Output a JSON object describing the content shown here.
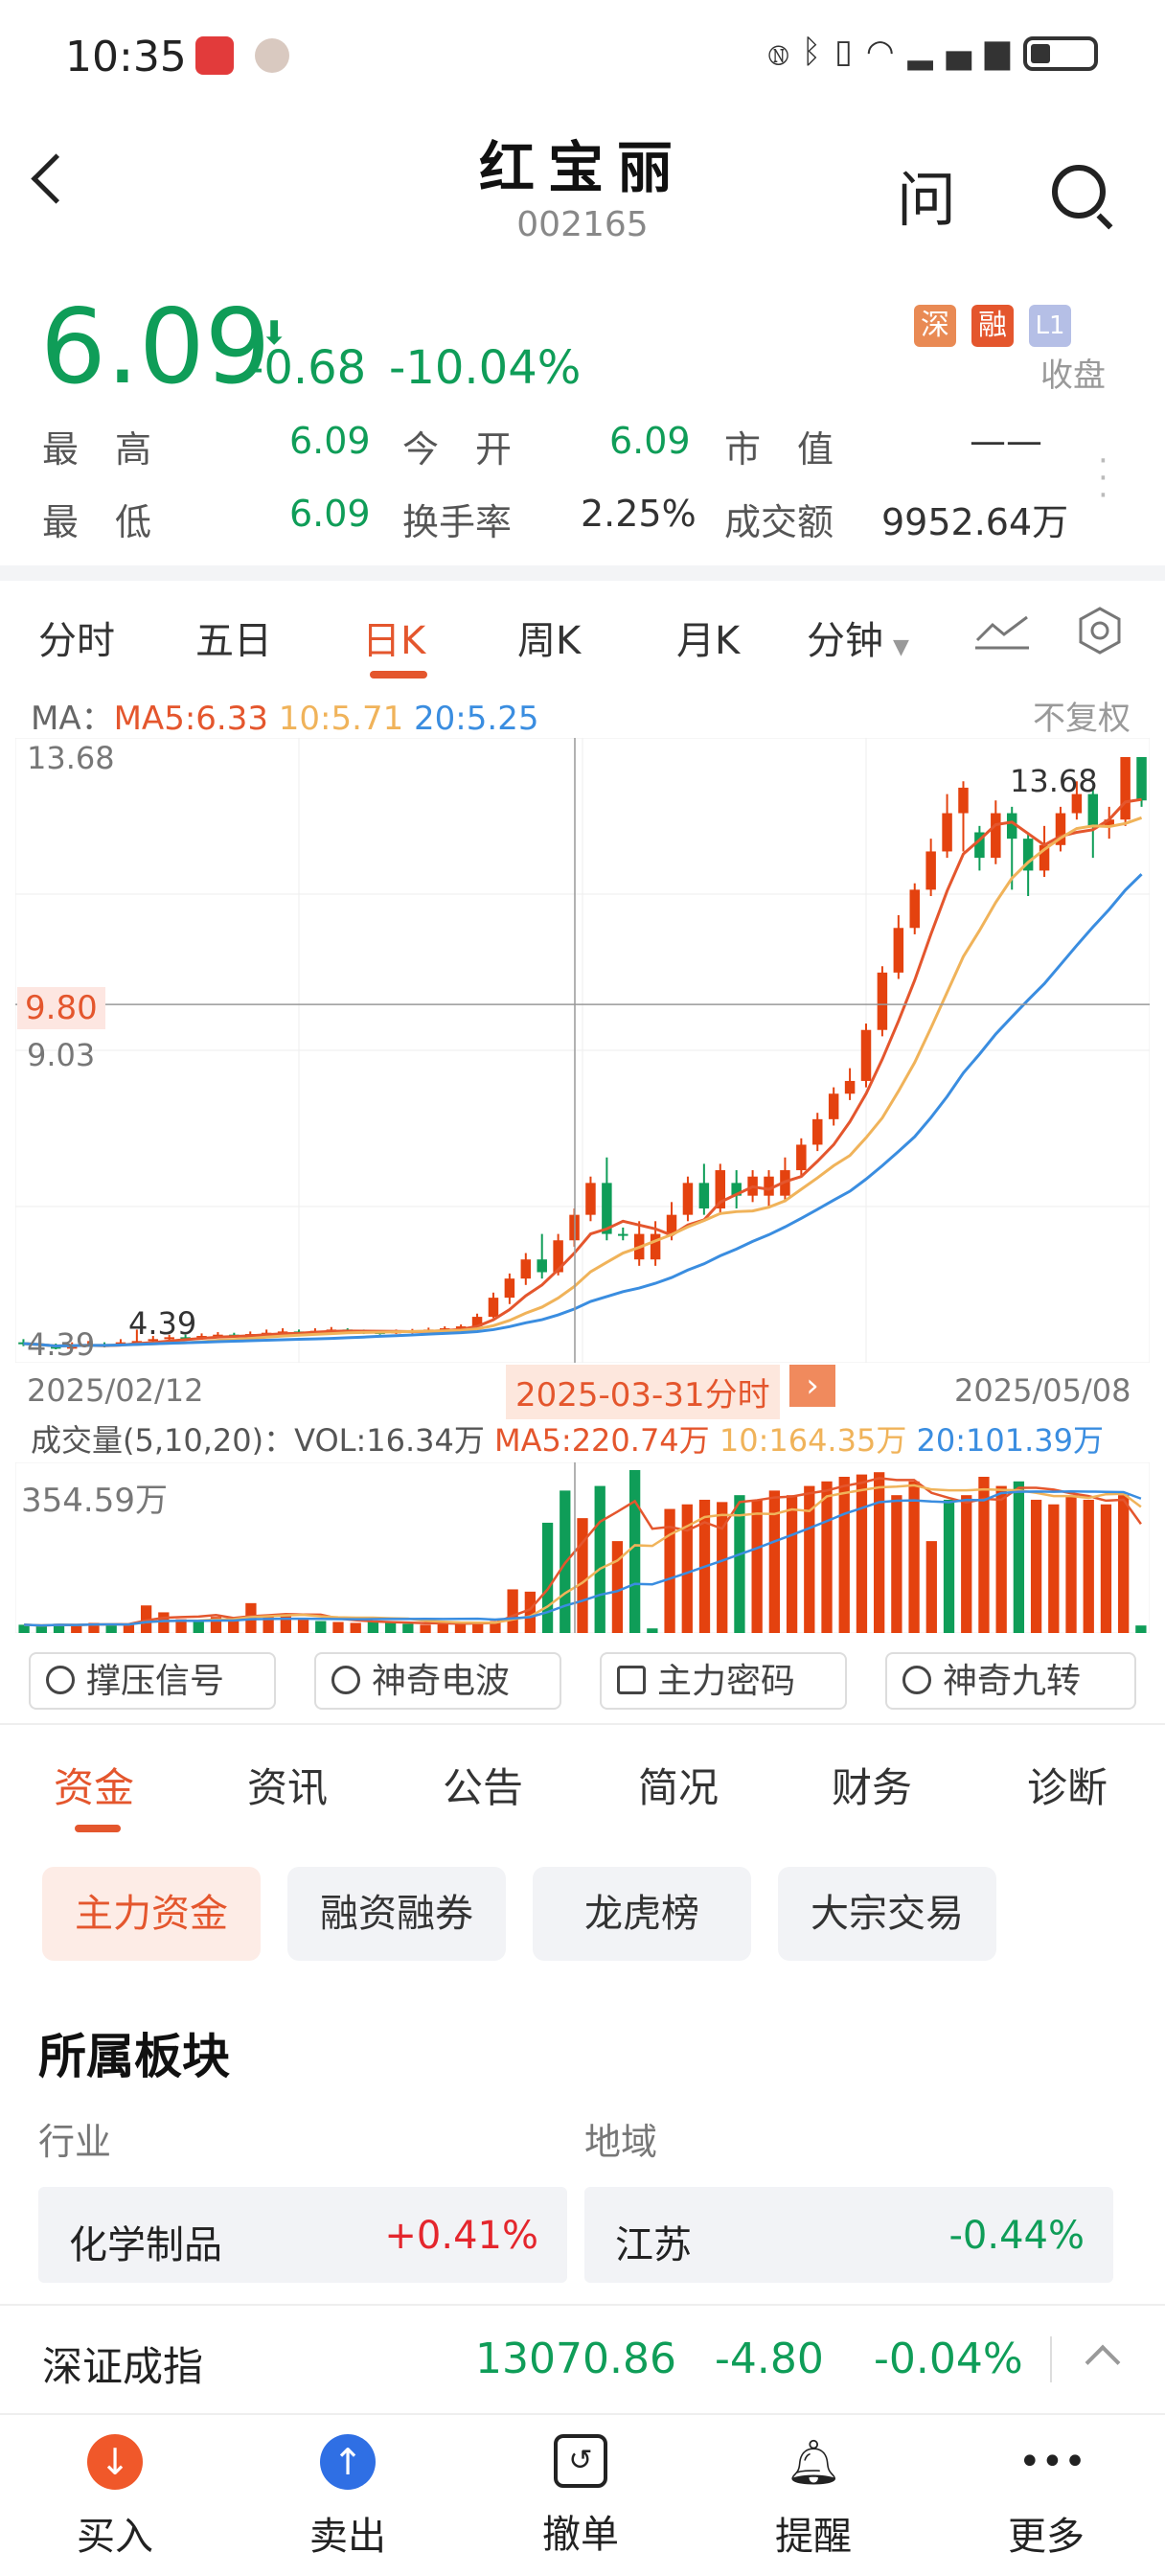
{
  "status_bar": {
    "time": "10:35"
  },
  "header": {
    "title": "红宝丽",
    "code": "002165"
  },
  "quote": {
    "price": "6.09",
    "change": "-0.68",
    "change_pct": "-10.04%",
    "badges": [
      "深",
      "融",
      "L1"
    ],
    "state": "收盘",
    "high_label": "最　高",
    "high": "6.09",
    "open_label": "今　开",
    "open": "6.09",
    "mcap_label": "市　值",
    "mcap": "——",
    "low_label": "最　低",
    "low": "6.09",
    "turnover_label": "换手率",
    "turnover": "2.25%",
    "amount_label": "成交额",
    "amount": "9952.64万"
  },
  "chart_tabs": [
    "分时",
    "五日",
    "日K",
    "周K",
    "月K",
    "分钟"
  ],
  "active_chart_tab": "日K",
  "ma_legend": {
    "prefix": "MA：",
    "ma5": "MA5:6.33",
    "ma10": "10:5.71",
    "ma20": "20:5.25",
    "adjust": "不复权"
  },
  "price_axis": {
    "top": "13.68",
    "cross": "9.80",
    "mid": "9.03",
    "bottom": "4.39",
    "high_mark": "13.68",
    "low_mark": "4.39"
  },
  "date_axis": {
    "start": "2025/02/12",
    "end": "2025/05/08",
    "cursor": "2025-03-31分时"
  },
  "vol_legend": {
    "prefix": "成交量(5,10,20)：",
    "vol": "VOL:16.34万",
    "ma5": "MA5:220.74万",
    "ma10": "10:164.35万",
    "ma20": "20:101.39万",
    "max": "354.59万"
  },
  "colors": {
    "up": "#e4420f",
    "down": "#0f9d58",
    "ma5": "#e4562d",
    "ma10": "#f0b35a",
    "ma20": "#3a8de0",
    "accent": "#e4562d"
  },
  "chart_data": {
    "type": "candlestick",
    "range": [
      "2025/02/12",
      "2025/05/08"
    ],
    "ylim": [
      4.39,
      13.68
    ],
    "candles": [
      [
        4.5,
        4.48,
        4.55,
        4.44,
        0
      ],
      [
        4.48,
        4.45,
        4.52,
        4.42,
        0
      ],
      [
        4.45,
        4.4,
        4.48,
        4.39,
        0
      ],
      [
        4.4,
        4.46,
        4.5,
        4.39,
        1
      ],
      [
        4.46,
        4.47,
        4.52,
        4.43,
        1
      ],
      [
        4.47,
        4.45,
        4.5,
        4.42,
        0
      ],
      [
        4.45,
        4.5,
        4.55,
        4.44,
        1
      ],
      [
        4.5,
        4.52,
        4.7,
        4.48,
        1
      ],
      [
        4.52,
        4.55,
        4.6,
        4.5,
        1
      ],
      [
        4.55,
        4.58,
        4.62,
        4.52,
        1
      ],
      [
        4.58,
        4.56,
        4.62,
        4.54,
        0
      ],
      [
        4.56,
        4.6,
        4.64,
        4.54,
        1
      ],
      [
        4.6,
        4.62,
        4.66,
        4.58,
        1
      ],
      [
        4.62,
        4.6,
        4.65,
        4.57,
        0
      ],
      [
        4.6,
        4.63,
        4.67,
        4.58,
        1
      ],
      [
        4.63,
        4.65,
        4.7,
        4.6,
        1
      ],
      [
        4.65,
        4.67,
        4.72,
        4.62,
        1
      ],
      [
        4.67,
        4.66,
        4.7,
        4.63,
        0
      ],
      [
        4.66,
        4.68,
        4.72,
        4.64,
        1
      ],
      [
        4.68,
        4.7,
        4.74,
        4.66,
        1
      ],
      [
        4.7,
        4.68,
        4.72,
        4.64,
        0
      ],
      [
        4.68,
        4.66,
        4.7,
        4.63,
        0
      ],
      [
        4.66,
        4.65,
        4.68,
        4.62,
        0
      ],
      [
        4.65,
        4.67,
        4.7,
        4.63,
        1
      ],
      [
        4.67,
        4.68,
        4.71,
        4.64,
        1
      ],
      [
        4.68,
        4.7,
        4.73,
        4.66,
        1
      ],
      [
        4.7,
        4.72,
        4.75,
        4.68,
        1
      ],
      [
        4.72,
        4.75,
        4.78,
        4.7,
        1
      ],
      [
        4.75,
        4.9,
        4.95,
        4.72,
        1
      ],
      [
        4.9,
        5.2,
        5.28,
        4.88,
        1
      ],
      [
        5.2,
        5.5,
        5.58,
        5.1,
        1
      ],
      [
        5.5,
        5.8,
        5.9,
        5.4,
        1
      ],
      [
        5.8,
        5.6,
        6.2,
        5.5,
        0
      ],
      [
        5.6,
        6.1,
        6.2,
        5.55,
        1
      ],
      [
        6.1,
        6.5,
        6.6,
        6.0,
        1
      ],
      [
        6.5,
        7.0,
        7.1,
        6.4,
        1
      ],
      [
        7.0,
        6.2,
        7.4,
        6.1,
        0
      ],
      [
        6.2,
        6.2,
        6.3,
        6.1,
        0
      ],
      [
        6.2,
        5.8,
        6.4,
        5.7,
        1
      ],
      [
        5.8,
        6.2,
        6.4,
        5.7,
        1
      ],
      [
        6.2,
        6.5,
        6.7,
        6.1,
        1
      ],
      [
        6.5,
        7.0,
        7.1,
        6.4,
        1
      ],
      [
        7.0,
        6.6,
        7.3,
        6.5,
        0
      ],
      [
        6.6,
        7.2,
        7.3,
        6.5,
        1
      ],
      [
        7.0,
        6.8,
        7.2,
        6.6,
        0
      ],
      [
        6.8,
        7.1,
        7.2,
        6.7,
        1
      ],
      [
        7.1,
        6.8,
        7.2,
        6.6,
        1
      ],
      [
        6.8,
        7.2,
        7.4,
        6.7,
        1
      ],
      [
        7.2,
        7.6,
        7.7,
        7.1,
        1
      ],
      [
        7.6,
        8.0,
        8.1,
        7.5,
        1
      ],
      [
        8.0,
        8.4,
        8.5,
        7.9,
        1
      ],
      [
        8.4,
        8.6,
        8.8,
        8.3,
        1
      ],
      [
        8.6,
        9.4,
        9.5,
        8.5,
        1
      ],
      [
        9.4,
        10.3,
        10.4,
        9.3,
        1
      ],
      [
        10.3,
        11.0,
        11.2,
        10.2,
        1
      ],
      [
        11.0,
        11.6,
        11.7,
        10.9,
        1
      ],
      [
        11.6,
        12.2,
        12.4,
        11.5,
        1
      ],
      [
        12.2,
        12.8,
        13.1,
        12.1,
        1
      ],
      [
        12.8,
        13.2,
        13.3,
        12.2,
        1
      ],
      [
        12.5,
        12.1,
        12.6,
        11.9,
        0
      ],
      [
        12.1,
        12.8,
        13.0,
        12.0,
        1
      ],
      [
        12.8,
        12.4,
        12.9,
        11.6,
        0
      ],
      [
        12.4,
        11.9,
        12.5,
        11.5,
        0
      ],
      [
        11.9,
        12.3,
        12.6,
        11.8,
        1
      ],
      [
        12.3,
        12.8,
        12.9,
        12.2,
        1
      ],
      [
        12.8,
        13.1,
        13.3,
        12.7,
        1
      ],
      [
        13.1,
        12.6,
        13.2,
        12.1,
        0
      ],
      [
        12.6,
        12.7,
        12.9,
        12.4,
        1
      ],
      [
        12.7,
        13.68,
        13.68,
        12.6,
        1
      ],
      [
        13.68,
        13.0,
        13.3,
        12.9,
        0
      ]
    ],
    "volumes": [
      [
        18,
        0
      ],
      [
        15,
        0
      ],
      [
        20,
        0
      ],
      [
        17,
        1
      ],
      [
        22,
        1
      ],
      [
        20,
        0
      ],
      [
        18,
        1
      ],
      [
        60,
        1
      ],
      [
        45,
        1
      ],
      [
        30,
        1
      ],
      [
        25,
        0
      ],
      [
        35,
        1
      ],
      [
        28,
        1
      ],
      [
        65,
        1
      ],
      [
        40,
        1
      ],
      [
        38,
        1
      ],
      [
        30,
        1
      ],
      [
        26,
        0
      ],
      [
        24,
        1
      ],
      [
        22,
        1
      ],
      [
        25,
        0
      ],
      [
        22,
        0
      ],
      [
        20,
        0
      ],
      [
        18,
        1
      ],
      [
        20,
        1
      ],
      [
        22,
        1
      ],
      [
        24,
        1
      ],
      [
        26,
        1
      ],
      [
        95,
        1
      ],
      [
        90,
        1
      ],
      [
        240,
        0
      ],
      [
        310,
        0
      ],
      [
        250,
        1
      ],
      [
        320,
        0
      ],
      [
        200,
        1
      ],
      [
        354.59,
        0
      ],
      [
        10,
        0
      ],
      [
        270,
        1
      ],
      [
        280,
        1
      ],
      [
        290,
        1
      ],
      [
        285,
        1
      ],
      [
        300,
        0
      ],
      [
        290,
        1
      ],
      [
        310,
        1
      ],
      [
        300,
        1
      ],
      [
        320,
        1
      ],
      [
        330,
        1
      ],
      [
        340,
        1
      ],
      [
        345,
        1
      ],
      [
        350,
        1
      ],
      [
        300,
        1
      ],
      [
        330,
        1
      ],
      [
        200,
        1
      ],
      [
        290,
        0
      ],
      [
        300,
        1
      ],
      [
        340,
        1
      ],
      [
        320,
        1
      ],
      [
        330,
        0
      ],
      [
        290,
        1
      ],
      [
        280,
        1
      ],
      [
        300,
        1
      ],
      [
        290,
        1
      ],
      [
        280,
        1
      ],
      [
        300,
        1
      ],
      [
        16.34,
        0
      ]
    ]
  },
  "indicator_chips": [
    "撑压信号",
    "神奇电波",
    "主力密码",
    "神奇九转"
  ],
  "section_tabs": [
    "资金",
    "资讯",
    "公告",
    "简况",
    "财务",
    "诊断"
  ],
  "sub_chips": [
    "主力资金",
    "融资融券",
    "龙虎榜",
    "大宗交易"
  ],
  "sector": {
    "title": "所属板块",
    "industry_label": "行业",
    "region_label": "地域",
    "industry_name": "化学制品",
    "industry_pct": "+0.41%",
    "region_name": "江苏",
    "region_pct": "-0.44%"
  },
  "index_bar": {
    "name": "深证成指",
    "value": "13070.86",
    "change": "-4.80",
    "pct": "-0.04%"
  },
  "bottom_nav": [
    "买入",
    "卖出",
    "撤单",
    "提醒",
    "更多"
  ]
}
